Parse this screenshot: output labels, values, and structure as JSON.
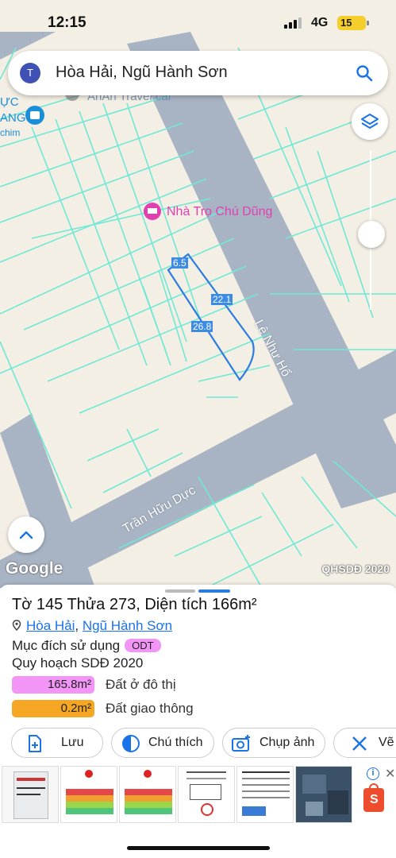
{
  "status_bar": {
    "time": "12:15",
    "network": "4G",
    "battery": "15"
  },
  "search": {
    "avatar_letter": "T",
    "query": "Hòa Hải, Ngũ Hành Sơn"
  },
  "map": {
    "labels": {
      "travel": "AnAn Travel car",
      "guesthouse": "Nhà Trọ Chú Dũng",
      "street_le": "Lê Như Hổ",
      "street_tran": "Trần Hữu Dực",
      "edge_1": "ỰC",
      "edge_2": "ANG",
      "edge_3": "chim"
    },
    "dimensions": {
      "top": "6.5",
      "right": "22.1",
      "left": "26.8"
    },
    "google": "Google",
    "credit": "QHSDĐ 2020"
  },
  "parcel": {
    "title": "Tờ 145 Thửa 273, Diện tích 166m²",
    "ward": "Hòa Hải",
    "district": "Ngũ Hành Sơn",
    "purpose_label": "Mục đích sử dụng",
    "purpose_code": "ODT",
    "plan_label": "Quy hoạch SDĐ 2020",
    "legend": [
      {
        "value": "165.8m²",
        "label": "Đất ở đô thị",
        "color": "#f394f7"
      },
      {
        "value": "0.2m²",
        "label": "Đất giao thông",
        "color": "#f5a623"
      }
    ]
  },
  "actions": {
    "save": "Lưu",
    "legend": "Chú thích",
    "photo": "Chụp ảnh",
    "measure": "Vẽ"
  },
  "colors": {
    "road": "#a8b4c4",
    "plot_line": "#6fe8d6",
    "accent": "#1a73e8",
    "poi": "#e040b0"
  }
}
